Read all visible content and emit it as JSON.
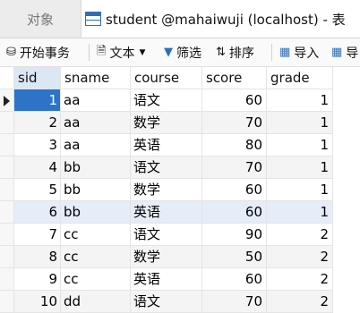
{
  "tabs": {
    "objects": "对象",
    "table": "student @mahaiwuji (localhost) - 表"
  },
  "toolbar": {
    "begin_transaction": "开始事务",
    "text": "文本",
    "filter": "筛选",
    "sort": "排序",
    "import": "导入",
    "export_partial": "导"
  },
  "columns": [
    "sid",
    "sname",
    "course",
    "score",
    "grade"
  ],
  "rows": [
    [
      "1",
      "aa",
      "语文",
      "60",
      "1"
    ],
    [
      "2",
      "aa",
      "数学",
      "70",
      "1"
    ],
    [
      "3",
      "aa",
      "英语",
      "80",
      "1"
    ],
    [
      "4",
      "bb",
      "语文",
      "70",
      "1"
    ],
    [
      "5",
      "bb",
      "数学",
      "60",
      "1"
    ],
    [
      "6",
      "bb",
      "英语",
      "60",
      "1"
    ],
    [
      "7",
      "cc",
      "语文",
      "90",
      "2"
    ],
    [
      "8",
      "cc",
      "数学",
      "50",
      "2"
    ],
    [
      "9",
      "cc",
      "英语",
      "60",
      "2"
    ],
    [
      "10",
      "dd",
      "语文",
      "70",
      "2"
    ]
  ],
  "colors": {
    "selected_cell": "#2d73c8",
    "highlight_row": "#e5edf8",
    "accent": "#2f6fb8"
  }
}
